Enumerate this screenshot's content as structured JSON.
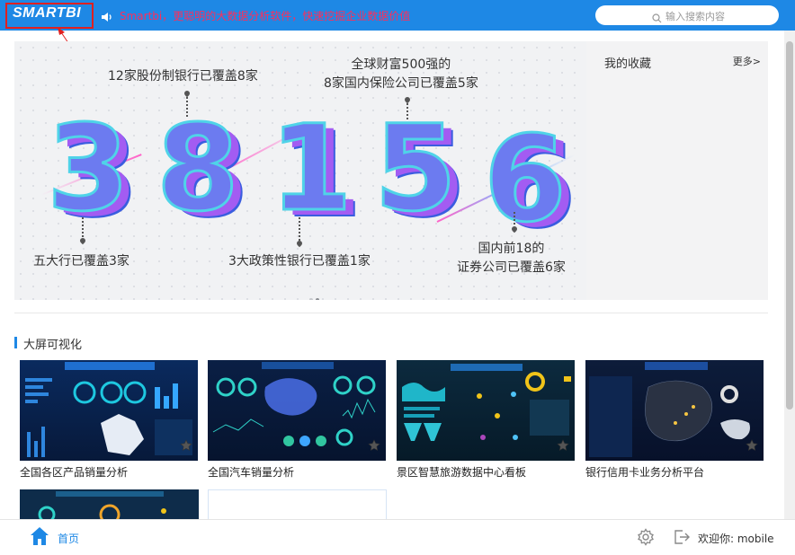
{
  "header": {
    "logo_text": "SMARTBI",
    "slogan": "Smartbi，更聪明的大数据分析软件，快速挖掘企业数据价值",
    "search_placeholder": "输入搜索内容",
    "speaker_icon": "speaker-icon",
    "colors": {
      "bar": "#1e88e5",
      "slogan": "#ff2d5a",
      "annotation": "#e02020"
    }
  },
  "banner": {
    "digits": [
      "3",
      "8",
      "1",
      "5",
      "6"
    ],
    "annotations": {
      "a1": "12家股份制银行已覆盖8家",
      "a2_line1": "全球财富500强的",
      "a2_line2": "8家国内保险公司已覆盖5家",
      "a3": "五大行已覆盖3家",
      "a4": "3大政策性银行已覆盖1家",
      "a5_line1": "国内前18的",
      "a5_line2": "证券公司已覆盖6家"
    },
    "favorites_title": "我的收藏",
    "favorites_more": "更多>",
    "carousel": {
      "count": 2,
      "active": 1
    }
  },
  "section": {
    "title": "大屏可视化"
  },
  "cards": [
    {
      "label": "全国各区产品销量分析"
    },
    {
      "label": "全国汽车销量分析"
    },
    {
      "label": "景区智慧旅游数据中心看板"
    },
    {
      "label": "银行信用卡业务分析平台"
    }
  ],
  "bottom": {
    "home_label": "首页",
    "welcome": "欢迎你: mobile",
    "icons": [
      "home-icon",
      "gear-icon",
      "logout-icon"
    ]
  }
}
